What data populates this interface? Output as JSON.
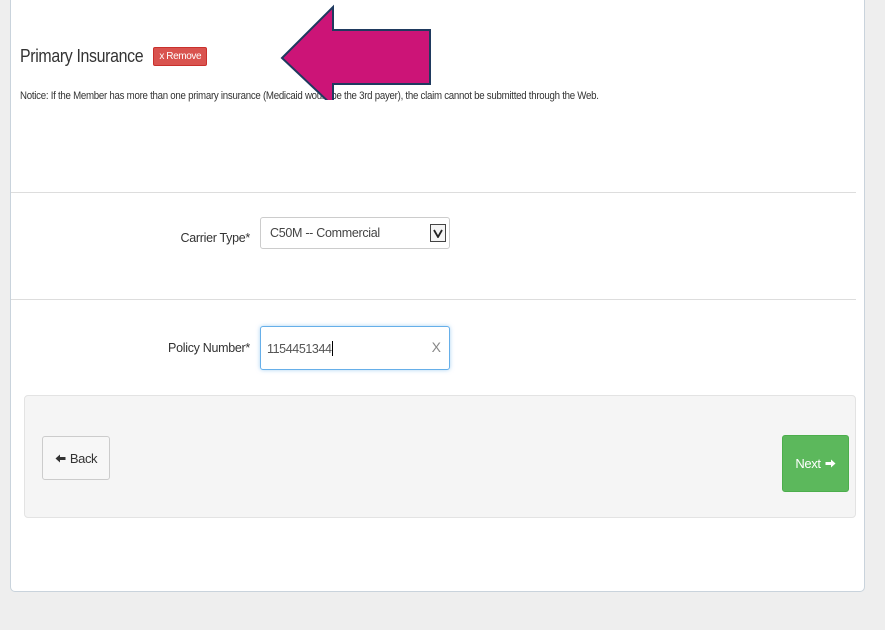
{
  "section": {
    "title": "Primary Insurance",
    "remove_label": "x Remove",
    "notice": "Notice: If the Member has more than one primary insurance (Medicaid would be the 3rd payer), the claim cannot be submitted through the Web."
  },
  "carrier_type": {
    "label": "Carrier Type*",
    "selected": "C50M -- Commercial"
  },
  "policy_number": {
    "label": "Policy Number*",
    "value": "1154451344",
    "clear_glyph": "X"
  },
  "footer": {
    "back_label": "Back",
    "next_label": "Next"
  },
  "icons": {
    "back": "arrow-left-icon",
    "next": "arrow-right-icon",
    "dropdown": "chevron-down-icon",
    "annotation": "pointer-arrow-icon"
  },
  "colors": {
    "remove": "#d9534f",
    "next": "#5cb85c",
    "annotation_arrow": "#cc1477"
  }
}
